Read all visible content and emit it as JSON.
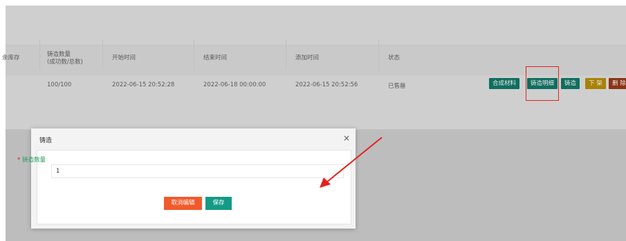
{
  "table": {
    "columns": [
      {
        "label": "余库存"
      },
      {
        "label": "铸造数量",
        "sub": "(成功数/总数)"
      },
      {
        "label": "开始时间"
      },
      {
        "label": "结束时间"
      },
      {
        "label": "添加时间"
      },
      {
        "label": "状态"
      }
    ],
    "row": {
      "count": "100/100",
      "start": "2022-06-15 20:52:28",
      "end": "2022-06-18 00:00:00",
      "added": "2022-06-15 20:52:56",
      "status": "已售罄"
    },
    "actions": [
      "合成材料",
      "铸造明细",
      "铸造",
      "下 架",
      "删 除"
    ]
  },
  "modal": {
    "title": "铸造",
    "close": "×",
    "field_label": "铸造数量",
    "required_mark": "*",
    "field_value": "1",
    "cancel_label": "取消编辑",
    "save_label": "保存"
  },
  "colors": {
    "teal": "#0f6e5f",
    "yellow": "#a88208",
    "red": "#8b3416",
    "cancel": "#f25a2b",
    "save": "#159a86",
    "highlight": "#e6201b"
  }
}
